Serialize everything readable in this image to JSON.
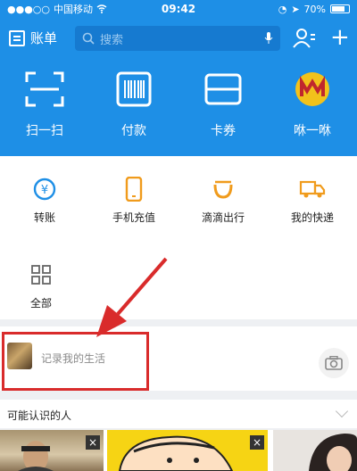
{
  "status": {
    "carrier": "中国移动",
    "time": "09:42",
    "battery": "70%"
  },
  "topbar": {
    "bill_label": "账单",
    "search_placeholder": "搜索"
  },
  "quick_actions": [
    {
      "label": "扫一扫",
      "icon": "scan-icon"
    },
    {
      "label": "付款",
      "icon": "barcode-icon"
    },
    {
      "label": "卡券",
      "icon": "card-icon"
    },
    {
      "label": "咻一咻",
      "icon": "shake-logo-icon"
    }
  ],
  "services": [
    {
      "label": "转账",
      "icon": "transfer-icon"
    },
    {
      "label": "手机充值",
      "icon": "phone-icon"
    },
    {
      "label": "滴滴出行",
      "icon": "didi-icon"
    },
    {
      "label": "我的快递",
      "icon": "truck-icon"
    },
    {
      "label": "全部",
      "icon": "grid-icon"
    }
  ],
  "life": {
    "placeholder": "记录我的生活"
  },
  "people": {
    "title": "可能认识的人",
    "close": "×"
  },
  "colors": {
    "header_blue": "#1e8fe6",
    "annotation_red": "#d92b2b",
    "icon_blue": "#1e8fe6",
    "icon_orange": "#f09b1c"
  }
}
